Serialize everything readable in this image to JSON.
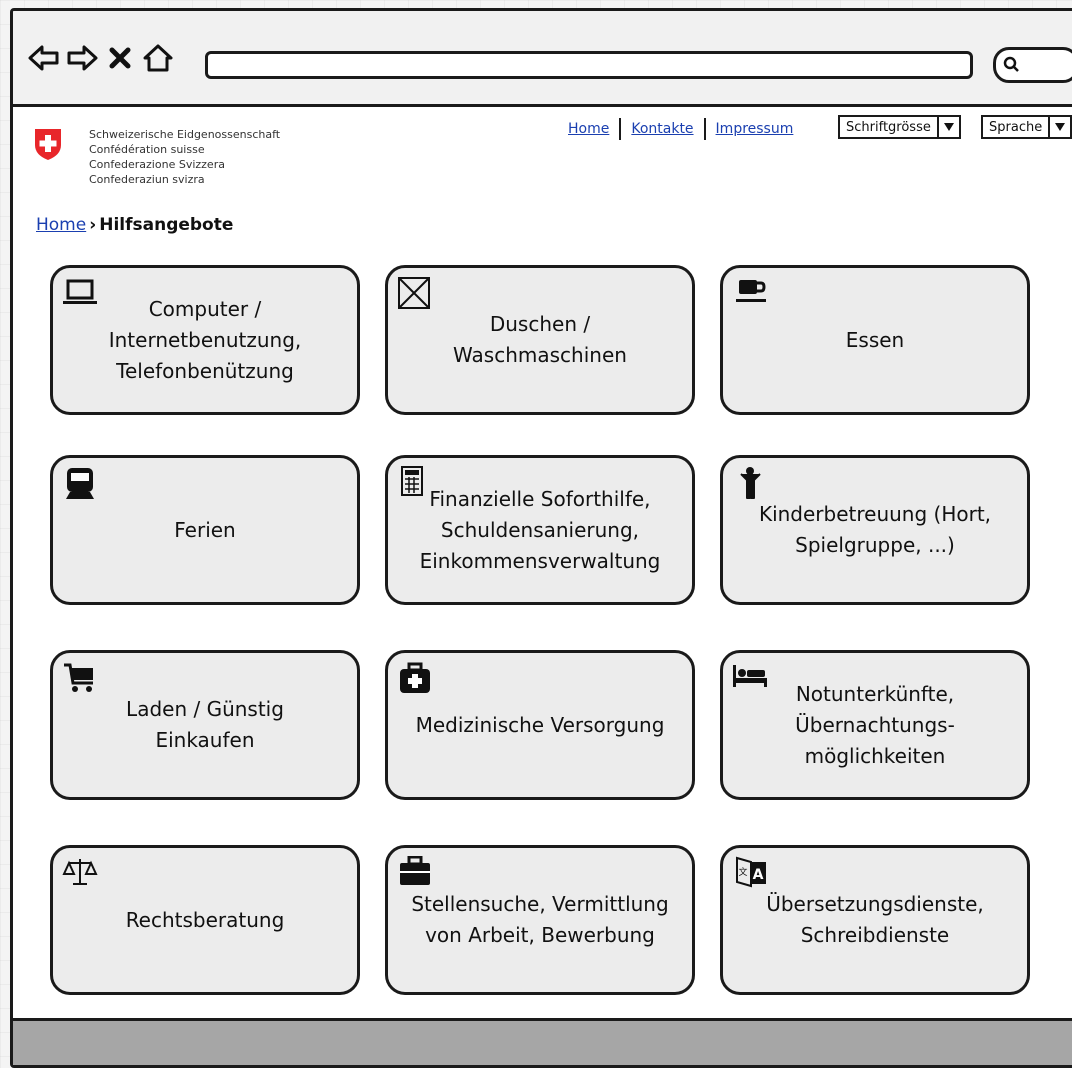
{
  "header": {
    "confederation_lines": [
      "Schweizerische Eidgenossenschaft",
      "Confédération suisse",
      "Confederazione Svizzera",
      "Confederaziun svizra"
    ],
    "links": [
      "Home",
      "Kontakte",
      "Impressum"
    ],
    "font_size_select": "Schriftgrösse",
    "language_select": "Sprache"
  },
  "breadcrumb": {
    "home": "Home",
    "current": "Hilfsangebote"
  },
  "tiles": [
    {
      "label": "Computer /\nInternetbenutzung,\nTelefonbenützung",
      "icon": "laptop-icon"
    },
    {
      "label": "Duschen /\nWaschmaschinen",
      "icon": "image-placeholder-icon"
    },
    {
      "label": "Essen",
      "icon": "coffee-cup-icon"
    },
    {
      "label": "Ferien",
      "icon": "train-icon"
    },
    {
      "label": "Finanzielle Soforthilfe,\nSchuldensanierung,\nEinkommensverwaltung",
      "icon": "calculator-icon"
    },
    {
      "label": "Kinderbetreuung (Hort,\nSpielgruppe, ...)",
      "icon": "child-icon"
    },
    {
      "label": "Laden / Günstig\nEinkaufen",
      "icon": "shopping-cart-icon"
    },
    {
      "label": "Medizinische Versorgung",
      "icon": "medkit-icon"
    },
    {
      "label": "Notunterkünfte,\nÜbernachtungs-\nmöglichkeiten",
      "icon": "bed-icon"
    },
    {
      "label": "Rechtsberatung",
      "icon": "balance-scale-icon"
    },
    {
      "label": "Stellensuche, Vermittlung\nvon Arbeit, Bewerbung",
      "icon": "briefcase-icon"
    },
    {
      "label": "Übersetzungsdienste,\nSchreibdienste",
      "icon": "translate-icon"
    }
  ],
  "colors": {
    "link": "#1a3fb0",
    "swiss_red": "#e8262a",
    "tile_bg": "#ececec",
    "statusbar": "#a6a6a6"
  }
}
